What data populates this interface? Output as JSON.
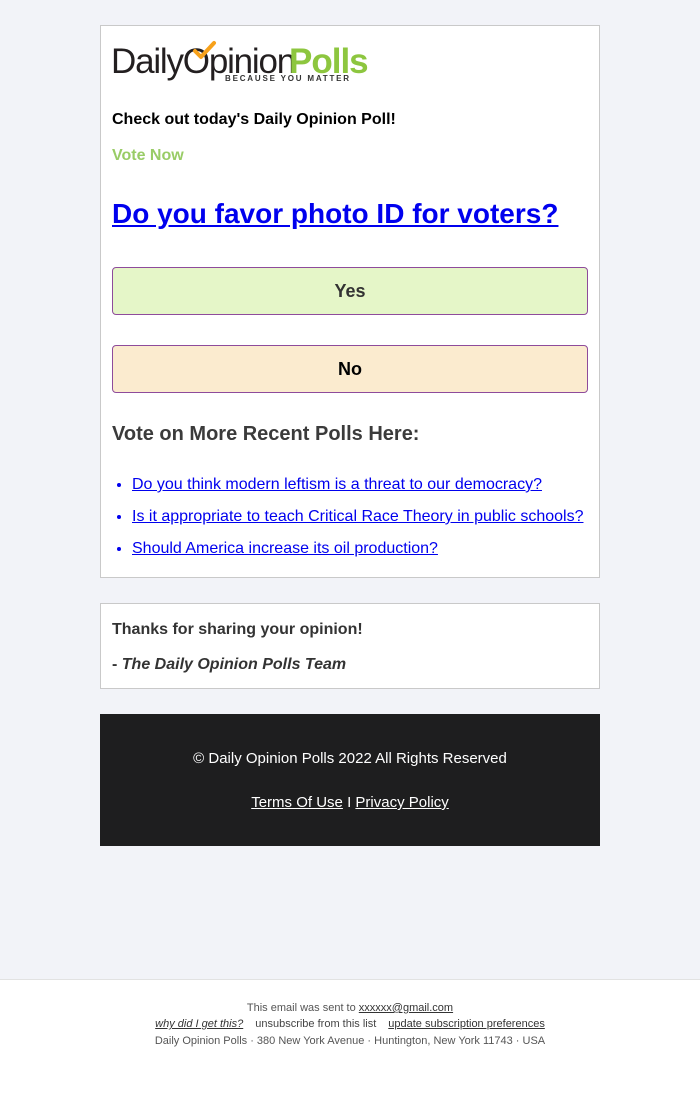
{
  "logo": {
    "part_dark": "DailyOpinion",
    "part_green": "Polls",
    "tagline": "BECAUSE YOU MATTER",
    "colors": {
      "dark": "#231f20",
      "green": "#8dc63f",
      "check": "#f7a11a"
    }
  },
  "intro": "Check out today's Daily Opinion Poll!",
  "vote_now": "Vote Now",
  "question": "Do you favor photo ID for voters?",
  "options": [
    {
      "label": "Yes",
      "bg": "#e5f6c8"
    },
    {
      "label": "No",
      "bg": "#fbebcf"
    }
  ],
  "more_polls": {
    "heading": "Vote on More Recent Polls Here:",
    "items": [
      "Do you think modern leftism is a threat to our democracy?",
      "Is it appropriate to teach Critical Race Theory in public schools?",
      "Should America increase its oil production?"
    ]
  },
  "thanks": {
    "line": "Thanks for sharing your opinion!",
    "dash": "- ",
    "signature": "The Daily Opinion Polls Team"
  },
  "footer": {
    "copyright": "© Daily Opinion Polls 2022 All Rights Reserved",
    "terms": "Terms Of Use",
    "separator": " I ",
    "privacy": "Privacy Policy"
  },
  "email_footer": {
    "sent_to_prefix": "This email was sent to ",
    "email": "xxxxxx@gmail.com",
    "why": "why did I get this?",
    "unsubscribe": "unsubscribe from this list",
    "preferences": "update subscription preferences",
    "address": "Daily Opinion Polls · 380 New York Avenue · Huntington, New York 11743 · USA"
  }
}
